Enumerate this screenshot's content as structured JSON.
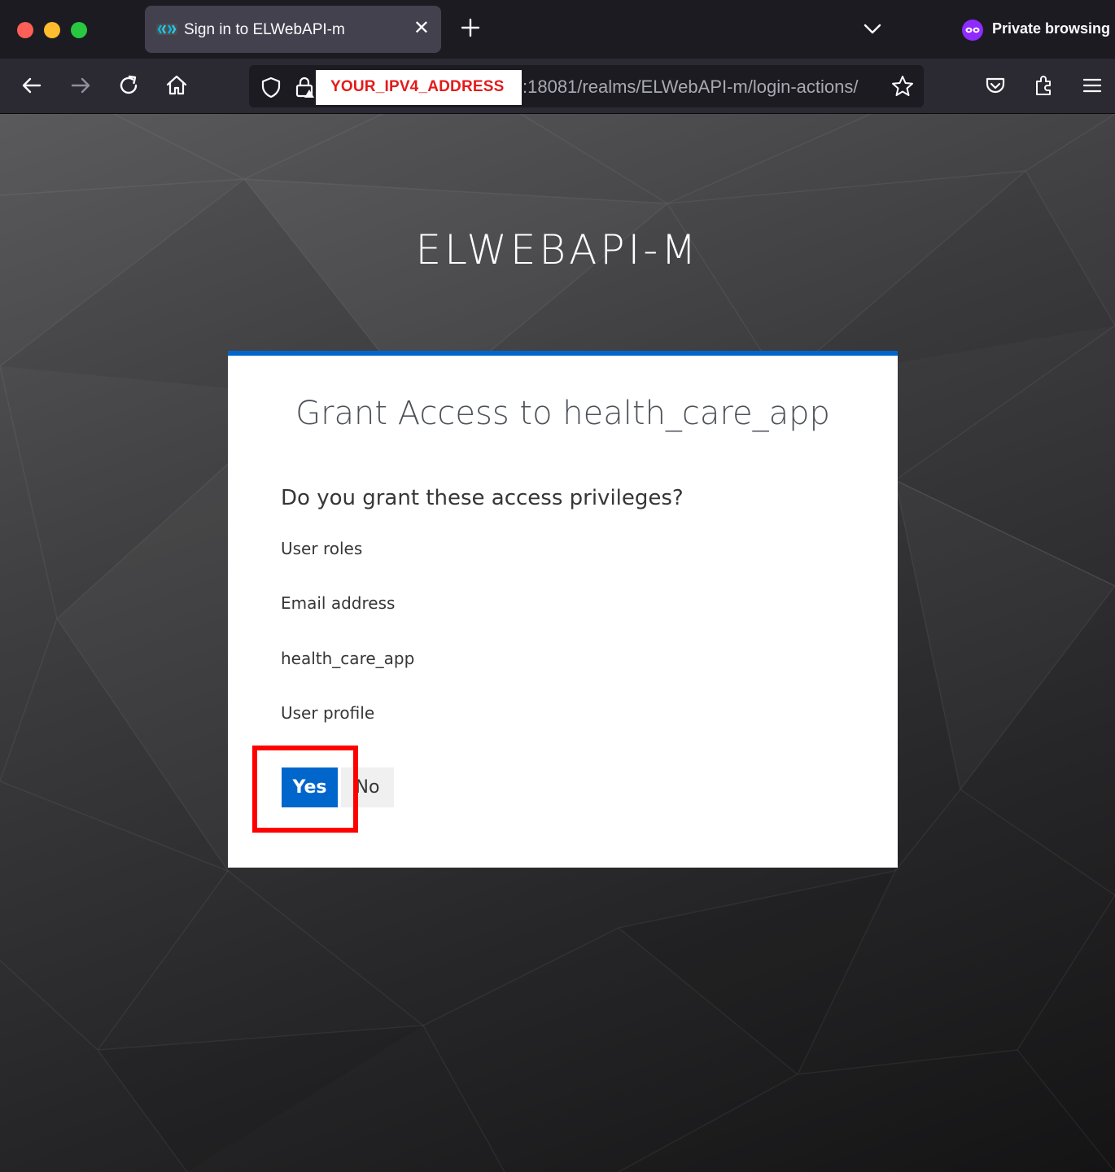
{
  "browser": {
    "tab": {
      "title": "Sign in to ELWebAPI-m",
      "favicon": "keycloak-favicon-icon",
      "close_glyph": "✕"
    },
    "private_browsing_label": "Private browsing",
    "address_bar": {
      "redacted_host_label": "YOUR_IPV4_ADDRESS",
      "url_rest": ":18081/realms/ELWebAPI-m/login-actions/"
    },
    "colors": {
      "redaction_text": "#e41a1a",
      "private_accent": "#8f2bff"
    }
  },
  "page": {
    "realm_title": "ELWEBAPI-M",
    "consent": {
      "title": "Grant Access to health_care_app",
      "question": "Do you grant these access privileges?",
      "permissions": [
        "User roles",
        "Email address",
        "health_care_app",
        "User profile"
      ],
      "yes_label": "Yes",
      "no_label": "No"
    },
    "colors": {
      "primary": "#0066cc",
      "annotation_box": "#ff0000"
    }
  }
}
